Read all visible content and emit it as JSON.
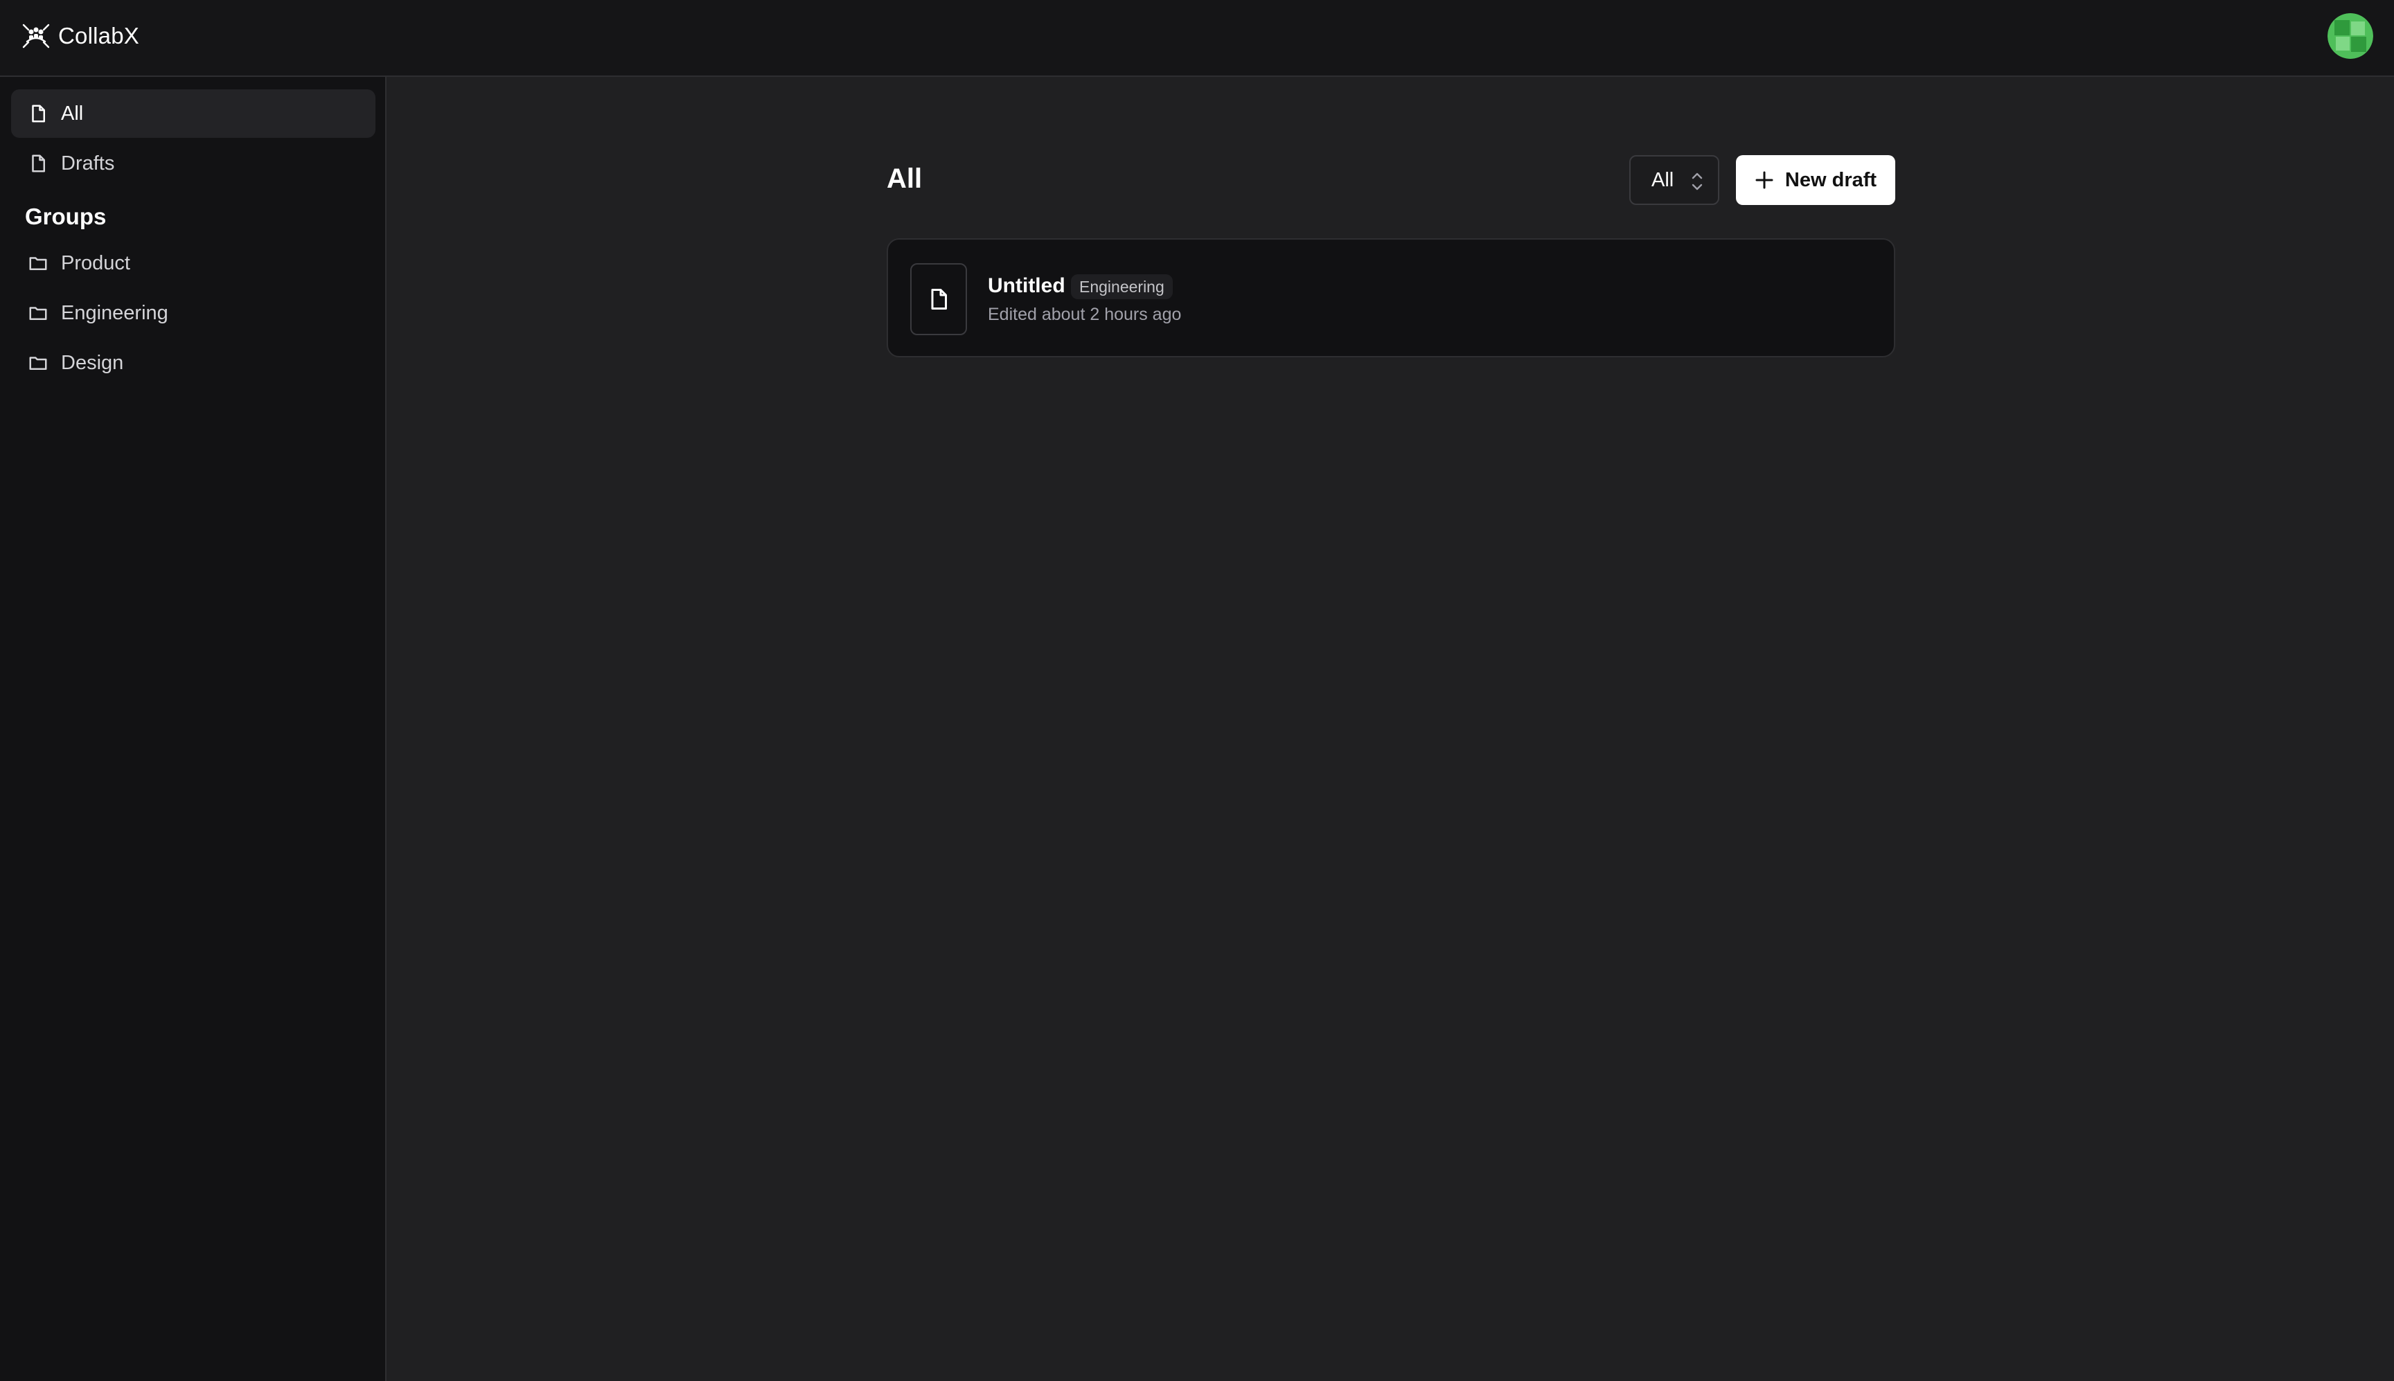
{
  "app": {
    "name": "CollabX"
  },
  "sidebar": {
    "items": [
      {
        "label": "All",
        "icon": "file-icon",
        "active": true
      },
      {
        "label": "Drafts",
        "icon": "file-icon",
        "active": false
      }
    ],
    "groups_heading": "Groups",
    "groups": [
      {
        "label": "Product",
        "icon": "folder-icon"
      },
      {
        "label": "Engineering",
        "icon": "folder-icon"
      },
      {
        "label": "Design",
        "icon": "folder-icon"
      }
    ]
  },
  "main": {
    "title": "All",
    "filter": {
      "selected": "All"
    },
    "new_draft_label": "New draft",
    "documents": [
      {
        "title": "Untitled",
        "tag": "Engineering",
        "meta": "Edited about 2 hours ago"
      }
    ]
  },
  "colors": {
    "background": "#202022",
    "sidebar": "#121214",
    "topbar": "#151517",
    "primary_button": "#ffffff",
    "avatar_green": "#4fbf5a"
  }
}
